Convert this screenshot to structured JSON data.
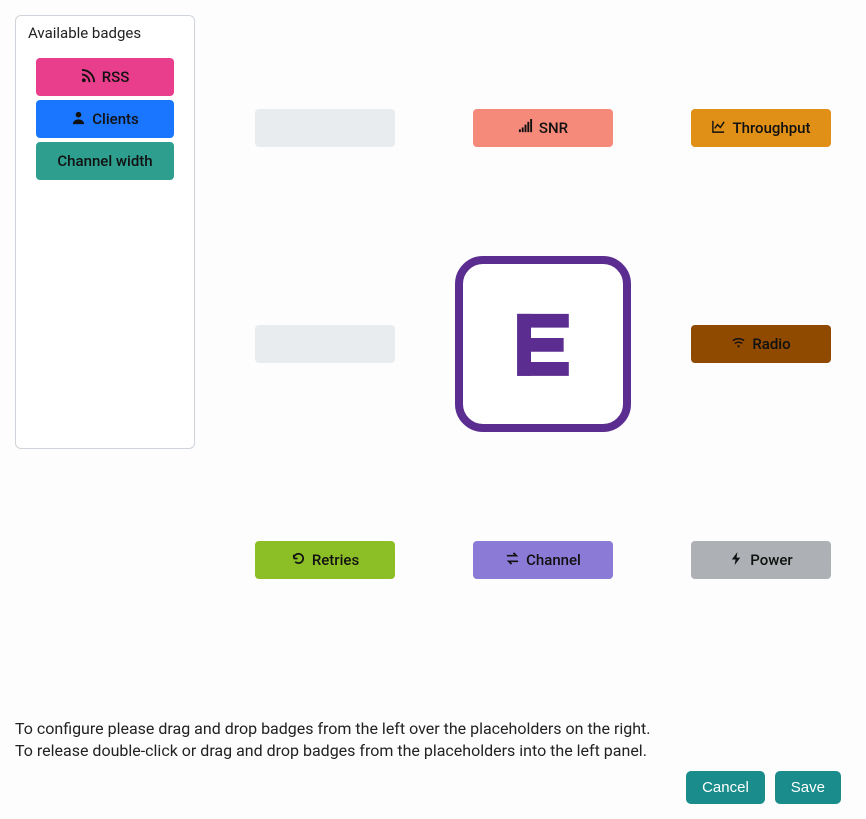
{
  "panel": {
    "title": "Available badges",
    "items": [
      {
        "label": "RSS",
        "icon": "rss-icon",
        "colorClass": "badge-pink"
      },
      {
        "label": "Clients",
        "icon": "user-icon",
        "colorClass": "badge-blue"
      },
      {
        "label": "Channel width",
        "icon": "",
        "colorClass": "badge-teal"
      }
    ]
  },
  "grid": {
    "slots": [
      {
        "pos": "top-left",
        "empty": true
      },
      {
        "pos": "top-center",
        "label": "SNR",
        "icon": "signal-icon",
        "colorClass": "badge-salmon"
      },
      {
        "pos": "top-right",
        "label": "Throughput",
        "icon": "chart-icon",
        "colorClass": "badge-orange"
      },
      {
        "pos": "mid-left",
        "empty": true
      },
      {
        "pos": "mid-center",
        "center": true
      },
      {
        "pos": "mid-right",
        "label": "Radio",
        "icon": "wifi-icon",
        "colorClass": "badge-brown"
      },
      {
        "pos": "bot-left",
        "label": "Retries",
        "icon": "undo-icon",
        "colorClass": "badge-olive"
      },
      {
        "pos": "bot-center",
        "label": "Channel",
        "icon": "swap-icon",
        "colorClass": "badge-violet"
      },
      {
        "pos": "bot-right",
        "label": "Power",
        "icon": "bolt-icon",
        "colorClass": "badge-grey"
      }
    ]
  },
  "instructions": {
    "line1": "To configure please drag and drop badges from the left over the placeholders on the right.",
    "line2": "To release double-click or drag and drop badges from the placeholders into the left panel."
  },
  "footer": {
    "cancel": "Cancel",
    "save": "Save"
  }
}
